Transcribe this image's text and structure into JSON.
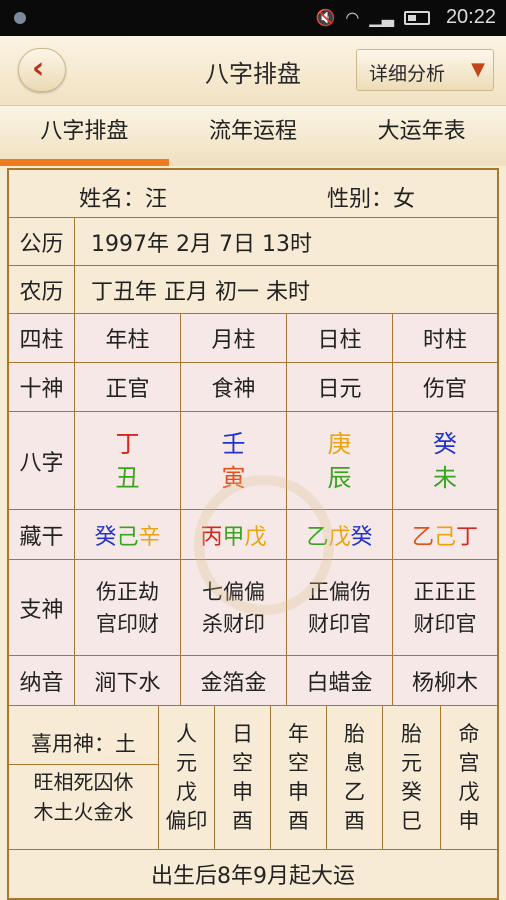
{
  "status_bar": {
    "time": "20:22"
  },
  "header": {
    "title": "八字排盘",
    "detail_button": "详细分析"
  },
  "tabs": [
    "八字排盘",
    "流年运程",
    "大运年表"
  ],
  "person": {
    "name": "姓名：汪",
    "gender": "性别：女"
  },
  "calendar": {
    "solar_label": "公历",
    "solar_value": "1997年  2月  7日  13时",
    "lunar_label": "农历",
    "lunar_value": "丁丑年  正月  初一  未时"
  },
  "pillars": {
    "label": "四柱",
    "headers": [
      "年柱",
      "月柱",
      "日柱",
      "时柱"
    ]
  },
  "ten_gods": {
    "label": "十神",
    "values": [
      "正官",
      "食神",
      "日元",
      "伤官"
    ]
  },
  "bazi": {
    "label": "八字",
    "stems": [
      "丁",
      "壬",
      "庚",
      "癸"
    ],
    "branches": [
      "丑",
      "寅",
      "辰",
      "未"
    ],
    "stem_colors": [
      "#d12a1e",
      "#2434c6",
      "#e8a40e",
      "#2434c6"
    ],
    "branch_colors": [
      "#3aa321",
      "#e0521c",
      "#3aa321",
      "#3aa321"
    ]
  },
  "hidden_stems": {
    "label": "藏干",
    "values": [
      [
        {
          "t": "癸",
          "c": "#2434c6"
        },
        {
          "t": "己",
          "c": "#3aa321"
        },
        {
          "t": "辛",
          "c": "#e8a40e"
        }
      ],
      [
        {
          "t": "丙",
          "c": "#d12a1e"
        },
        {
          "t": "甲",
          "c": "#3aa321"
        },
        {
          "t": "戊",
          "c": "#e8a40e"
        }
      ],
      [
        {
          "t": "乙",
          "c": "#3aa321"
        },
        {
          "t": "戊",
          "c": "#e8a40e"
        },
        {
          "t": "癸",
          "c": "#2434c6"
        }
      ],
      [
        {
          "t": "乙",
          "c": "#e0521c"
        },
        {
          "t": "己",
          "c": "#e8a40e"
        },
        {
          "t": "丁",
          "c": "#d12a1e"
        }
      ]
    ]
  },
  "branch_gods": {
    "label": "支神",
    "values": [
      [
        "伤正劫",
        "官印财"
      ],
      [
        "七偏偏",
        "杀财印"
      ],
      [
        "正偏伤",
        "财印官"
      ],
      [
        "正正正",
        "财印官"
      ]
    ]
  },
  "nayin": {
    "label": "纳音",
    "values": [
      "涧下水",
      "金箔金",
      "白蜡金",
      "杨柳木"
    ]
  },
  "favorable": {
    "text": "喜用神：土",
    "strength_line1": "旺相死囚休",
    "strength_line2": "木土火金水"
  },
  "extra_columns": [
    {
      "chars": [
        "人",
        "元",
        "戊",
        "偏印"
      ]
    },
    {
      "chars": [
        "日",
        "空",
        "申",
        "酉"
      ]
    },
    {
      "chars": [
        "年",
        "空",
        "申",
        "酉"
      ]
    },
    {
      "chars": [
        "胎",
        "息",
        "乙",
        "酉"
      ]
    },
    {
      "chars": [
        "胎",
        "元",
        "癸",
        "巳"
      ]
    },
    {
      "chars": [
        "命",
        "宫",
        "戊",
        "申"
      ]
    }
  ],
  "luck_start": "出生后8年9月起大运"
}
